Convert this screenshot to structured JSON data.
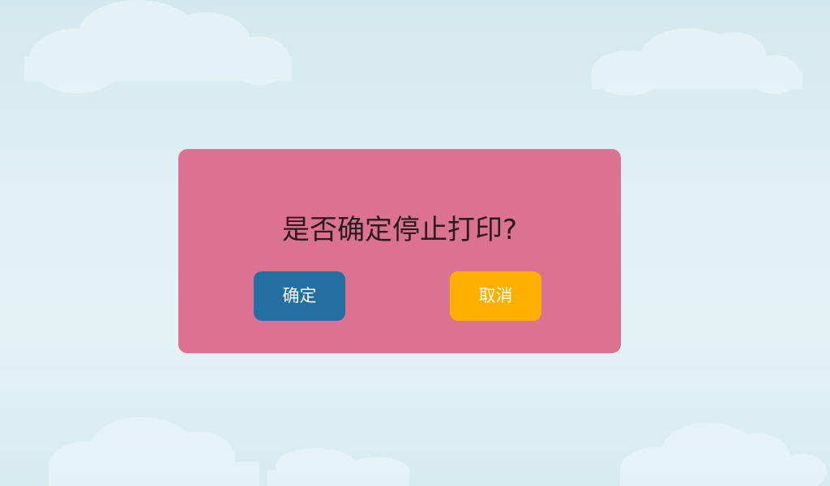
{
  "dialog": {
    "message": "是否确定停止打印?",
    "confirm_label": "确定",
    "cancel_label": "取消"
  },
  "colors": {
    "dialog_background": "#dc7292",
    "confirm_button": "#246fa2",
    "cancel_button": "#ffaf00",
    "sky": "#e2f1f4"
  }
}
